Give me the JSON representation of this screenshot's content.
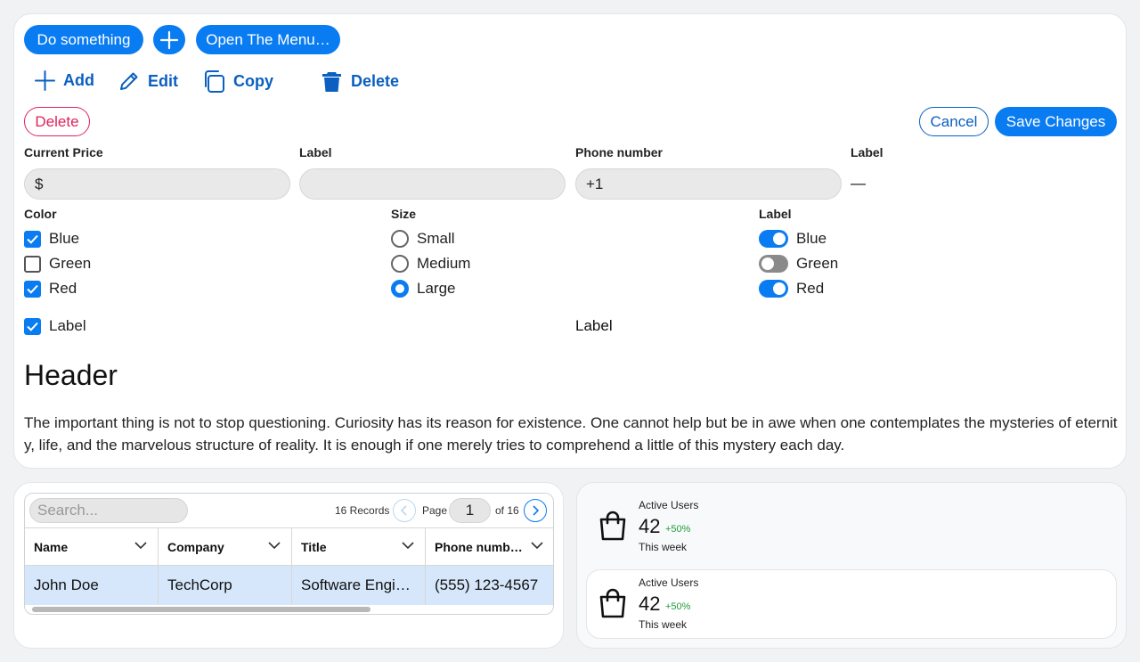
{
  "top_buttons": {
    "do_something": "Do something",
    "open_menu": "Open The Menu…"
  },
  "toolbar": {
    "add": "Add",
    "edit": "Edit",
    "copy": "Copy",
    "delete": "Delete"
  },
  "actions": {
    "delete": "Delete",
    "cancel": "Cancel",
    "save": "Save Changes"
  },
  "fields": {
    "price": {
      "label": "Current Price",
      "prefix": "$"
    },
    "label1": {
      "label": "Label",
      "value": ""
    },
    "phone": {
      "label": "Phone number",
      "value": "+1"
    },
    "label2": {
      "label": "Label",
      "value": "—"
    }
  },
  "color_group": {
    "label": "Color",
    "options": [
      {
        "label": "Blue",
        "checked": true
      },
      {
        "label": "Green",
        "checked": false
      },
      {
        "label": "Red",
        "checked": true
      }
    ]
  },
  "size_group": {
    "label": "Size",
    "options": [
      {
        "label": "Small",
        "selected": false
      },
      {
        "label": "Medium",
        "selected": false
      },
      {
        "label": "Large",
        "selected": true
      }
    ]
  },
  "toggle_group": {
    "label": "Label",
    "options": [
      {
        "label": "Blue",
        "on": true
      },
      {
        "label": "Green",
        "on": false
      },
      {
        "label": "Red",
        "on": true
      }
    ]
  },
  "bottom_row": {
    "checkbox_label": "Label",
    "switch_label": "Label"
  },
  "content": {
    "header": "Header",
    "paragraph": "The important thing is not to stop questioning. Curiosity has its reason for existence. One cannot help but be in awe when one contemplates the mysteries of eternity, life, and the marvelous structure of reality. It is enough if one merely tries to comprehend a little of this mystery each day."
  },
  "table": {
    "search_placeholder": "Search...",
    "records": "16 Records",
    "page_label": "Page",
    "page": "1",
    "of_pages": "of 16",
    "columns": [
      "Name",
      "Company",
      "Title",
      "Phone numb…"
    ],
    "rows": [
      [
        "John Doe",
        "TechCorp",
        "Software Engi…",
        "(555) 123-4567"
      ]
    ]
  },
  "stats": [
    {
      "title": "Active Users",
      "value": "42",
      "delta": "+50%",
      "sub": "This week"
    },
    {
      "title": "Active Users",
      "value": "42",
      "delta": "+50%",
      "sub": "This week"
    }
  ],
  "colors": {
    "accent": "#0a7cf2",
    "accent_dark": "#0a5fc0",
    "danger": "#e0245e",
    "positive": "#1f9d3a",
    "selected_row": "#d6e7fb"
  }
}
